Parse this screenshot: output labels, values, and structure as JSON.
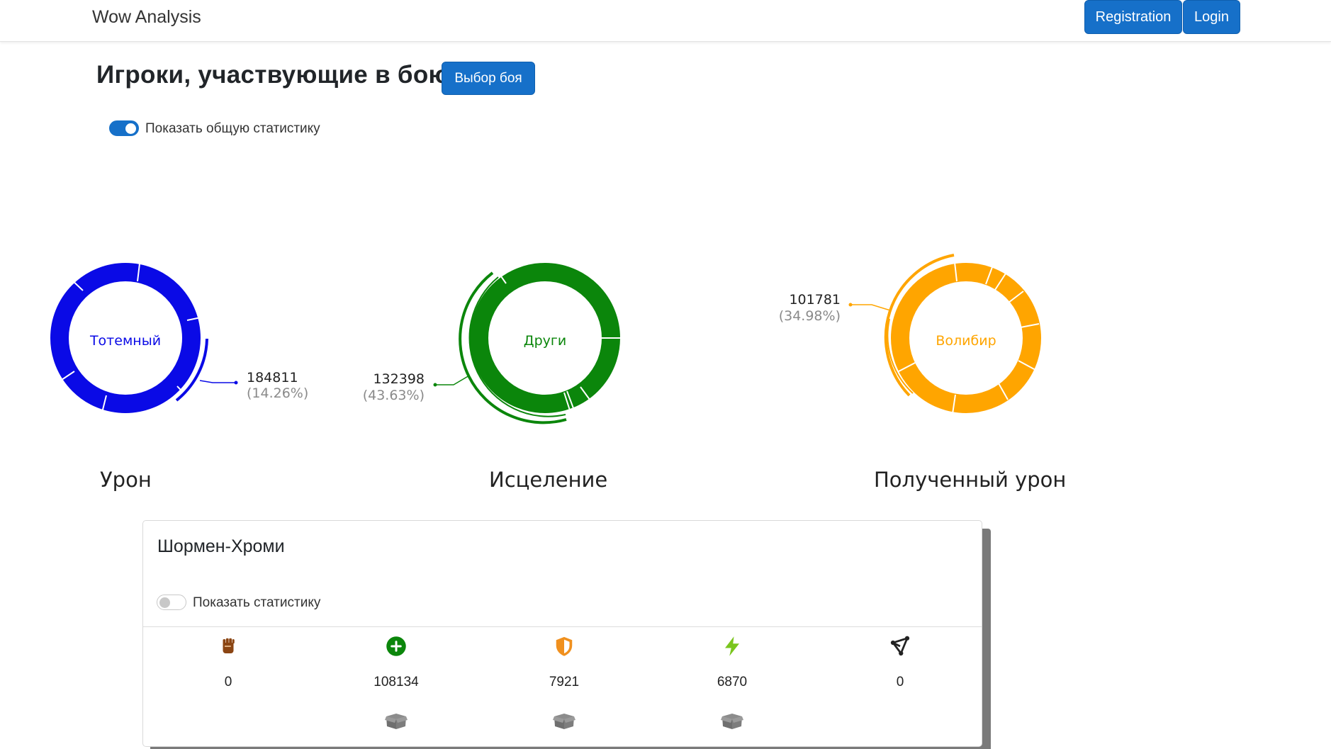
{
  "navbar": {
    "brand": "Wow Analysis",
    "registration_label": "Registration",
    "login_label": "Login"
  },
  "header": {
    "title": "Игроки, участвующие в бою",
    "fight_select_label": "Выбор боя"
  },
  "overall_toggle": {
    "label": "Показать общую статистику",
    "checked": true
  },
  "charts": [
    {
      "title": "Урон",
      "center_label": "Тотемный",
      "highlight_value": "184811",
      "highlight_percent": "(14.26%)",
      "color": "#0a0ae6"
    },
    {
      "title": "Исцеление",
      "center_label": "Други",
      "highlight_value": "132398",
      "highlight_percent": "(43.63%)",
      "color": "#0b860b"
    },
    {
      "title": "Полученный урон",
      "center_label": "Волибир",
      "highlight_value": "101781",
      "highlight_percent": "(34.98%)",
      "color": "#ffa500"
    }
  ],
  "player_card": {
    "name": "Шормен-Хроми",
    "toggle_label": "Показать статистику",
    "toggle_checked": false,
    "stats": [
      {
        "icon": "fist-icon",
        "value": "0",
        "color": "#8b4513",
        "has_box": false
      },
      {
        "icon": "plus-circle-icon",
        "value": "108134",
        "color": "#0b860b",
        "has_box": true
      },
      {
        "icon": "shield-icon",
        "value": "7921",
        "color": "#f0901e",
        "has_box": true
      },
      {
        "icon": "lightning-icon",
        "value": "6870",
        "color": "#7ac51e",
        "has_box": true
      },
      {
        "icon": "nodes-icon",
        "value": "0",
        "color": "#222222",
        "has_box": false
      }
    ]
  }
}
